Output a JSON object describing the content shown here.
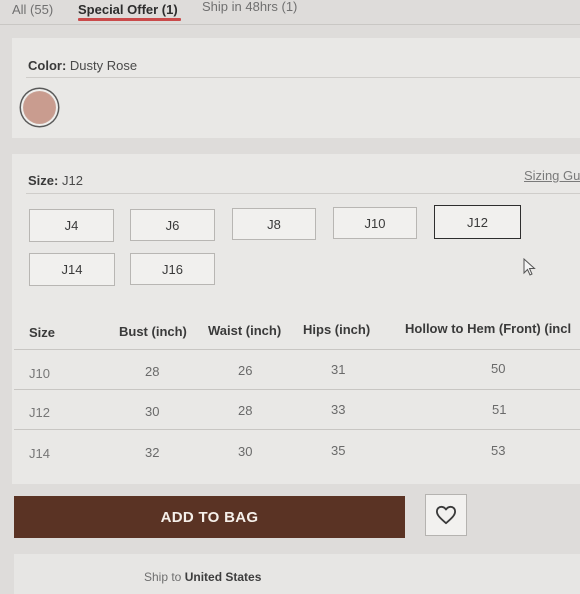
{
  "tabs": [
    {
      "label": "All (55)"
    },
    {
      "label": "Special Offer (1)",
      "active": true
    },
    {
      "label": "Ship in 48hrs (1)"
    }
  ],
  "color": {
    "label": "Color:",
    "value": "Dusty Rose",
    "swatch_hex": "#c99c8f"
  },
  "size": {
    "label": "Size:",
    "value": "J12",
    "sizing_guide": "Sizing Gu",
    "options": [
      "J4",
      "J6",
      "J8",
      "J10",
      "J12",
      "J14",
      "J16"
    ],
    "selected": "J12"
  },
  "size_table": {
    "headers": [
      "Size",
      "Bust (inch)",
      "Waist (inch)",
      "Hips (inch)",
      "Hollow to Hem (Front) (incl"
    ],
    "rows": [
      [
        "J10",
        "28",
        "26",
        "31",
        "50"
      ],
      [
        "J12",
        "30",
        "28",
        "33",
        "51"
      ],
      [
        "J14",
        "32",
        "30",
        "35",
        "53"
      ]
    ]
  },
  "actions": {
    "add_to_bag": "ADD TO BAG",
    "wishlist_icon": "heart-icon",
    "brand_color": "#5a3324"
  },
  "shipping": {
    "prefix": "Ship to",
    "country": "United States"
  }
}
